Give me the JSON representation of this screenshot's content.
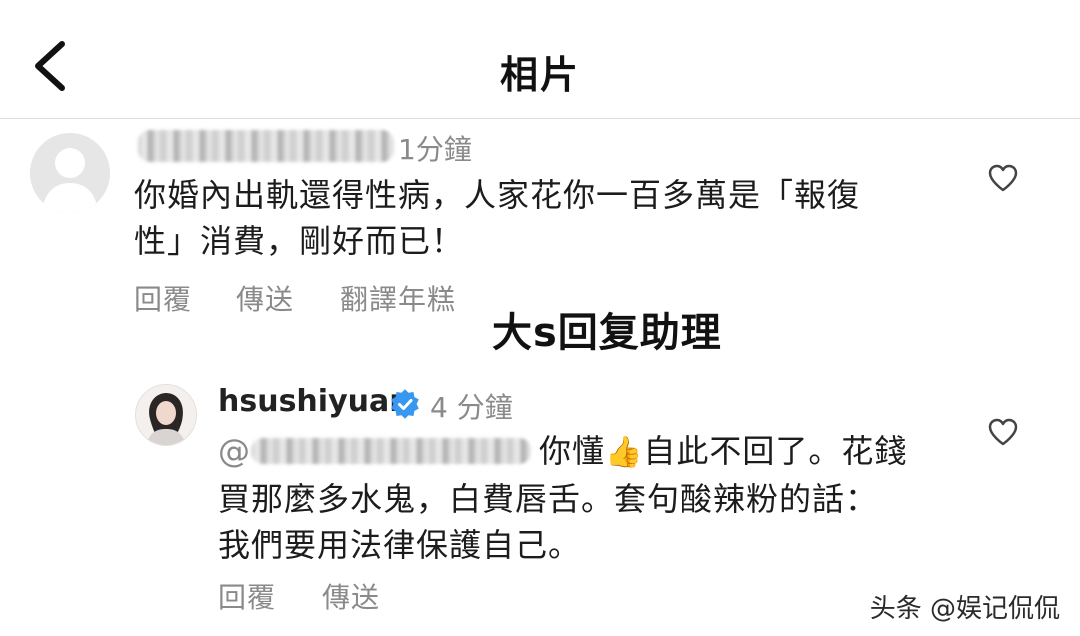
{
  "header": {
    "title": "相片"
  },
  "comment1": {
    "time": "1分鐘",
    "lines": [
      "你婚內出軌還得性病，人家花你一百多萬是「報復",
      "性」消費，剛好而已！"
    ],
    "actions": {
      "reply": "回覆",
      "send": "傳送",
      "translate": "翻譯年糕"
    }
  },
  "overlay_caption": "大s回复助理",
  "comment2": {
    "username": "hsushiyuan",
    "time": "4 分鐘",
    "mention_prefix": "@",
    "line1_a": "你懂",
    "thumbs": "👍",
    "line1_b": "自此不回了。花錢",
    "line2": "買那麼多水鬼，白費唇舌。套句酸辣粉的話：",
    "line3": "我們要用法律保護自己。",
    "actions": {
      "reply": "回覆",
      "send": "傳送"
    }
  },
  "watermark": "头条 @娱记侃侃",
  "icons": {
    "back": "chevron-left-icon",
    "like": "heart-outline-icon",
    "verified": "verified-badge-icon",
    "avatar": "default-avatar-icon"
  },
  "colors": {
    "verified": "#3897f0",
    "muted_text": "#8a8a8a"
  }
}
